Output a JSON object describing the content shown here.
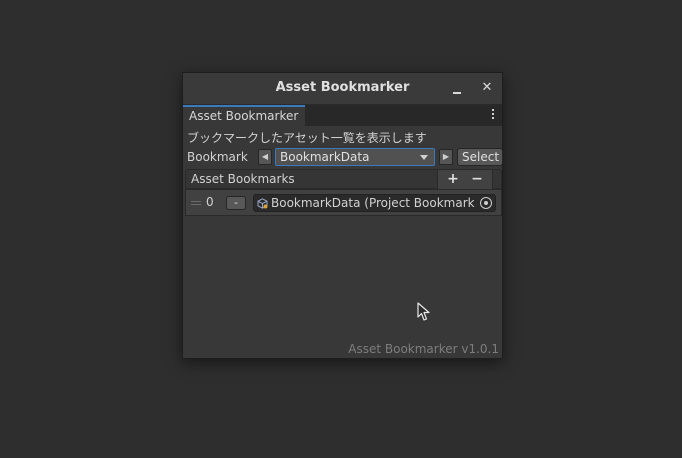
{
  "window": {
    "title": "Asset Bookmarker",
    "tab_label": "Asset Bookmarker",
    "description": "ブックマークしたアセット一覧を表示します",
    "bookmark_label": "Bookmark",
    "bookmark_selected": "BookmarkData",
    "select_label": "Select",
    "list_header": "Asset Bookmarks",
    "add_label": "+",
    "remove_label": "−",
    "items": [
      {
        "index": "0",
        "remove_label": "-",
        "object": "BookmarkData (Project Bookmark Data)"
      }
    ],
    "version": "Asset Bookmarker v1.0.1",
    "close_glyph": "✕"
  },
  "colors": {
    "background": "#2e2e2e",
    "window": "#383838",
    "accent": "#3a79bb"
  }
}
